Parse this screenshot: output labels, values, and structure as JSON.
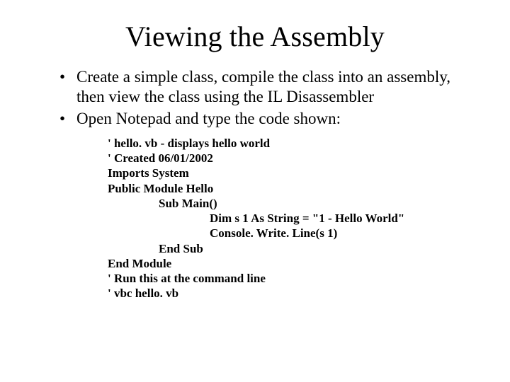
{
  "title": "Viewing the Assembly",
  "bullets": [
    "Create a simple class, compile the class into an assembly, then view the class using the IL Disassembler",
    "Open Notepad and type the code shown:"
  ],
  "code": {
    "l0": "' hello. vb - displays hello world",
    "l1": "' Created 06/01/2002",
    "l2": "Imports System",
    "l3": "Public Module Hello",
    "l4": "Sub Main()",
    "l5": "Dim s 1 As String = \"1 - Hello World\"",
    "l6": "Console. Write. Line(s 1)",
    "l7": "End Sub",
    "l8": "End Module",
    "l9": "' Run this at the command line",
    "l10": "' vbc hello. vb"
  }
}
